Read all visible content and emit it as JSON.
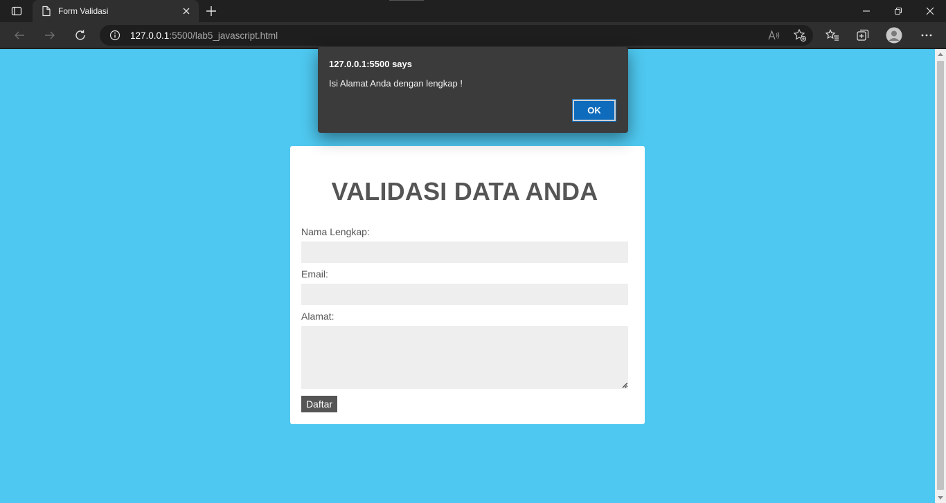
{
  "browser": {
    "tab_title": "Form Validasi",
    "url_host": "127.0.0.1",
    "url_rest": ":5500/lab5_javascript.html",
    "icons": {
      "tab_actions": "tab-actions-icon",
      "tab_page": "page-icon",
      "tab_close": "close-icon",
      "new_tab": "plus-icon",
      "back": "back-arrow-icon",
      "forward": "forward-arrow-icon",
      "refresh": "refresh-icon",
      "site_info": "info-icon",
      "read_aloud": "read-aloud-icon",
      "add_favorite": "star-add-icon",
      "favorites": "favorites-icon",
      "collections": "collections-icon",
      "profile": "profile-icon",
      "more": "more-icon",
      "minimize": "minimize-icon",
      "restore": "restore-icon",
      "close_window": "close-window-icon"
    }
  },
  "dialog": {
    "title": "127.0.0.1:5500 says",
    "message": "Isi Alamat Anda dengan lengkap !",
    "ok_label": "OK"
  },
  "form": {
    "heading": "VALIDASI DATA ANDA",
    "nama_label": "Nama Lengkap:",
    "nama_value": "",
    "email_label": "Email:",
    "email_value": "",
    "alamat_label": "Alamat:",
    "alamat_value": "",
    "submit_label": "Daftar"
  },
  "colors": {
    "page_background": "#4ec8f0",
    "card_background": "#ffffff",
    "heading_text": "#555555",
    "button_background": "#555555",
    "dialog_background": "#3b3b3b",
    "dialog_ok": "#0f6cbd"
  }
}
